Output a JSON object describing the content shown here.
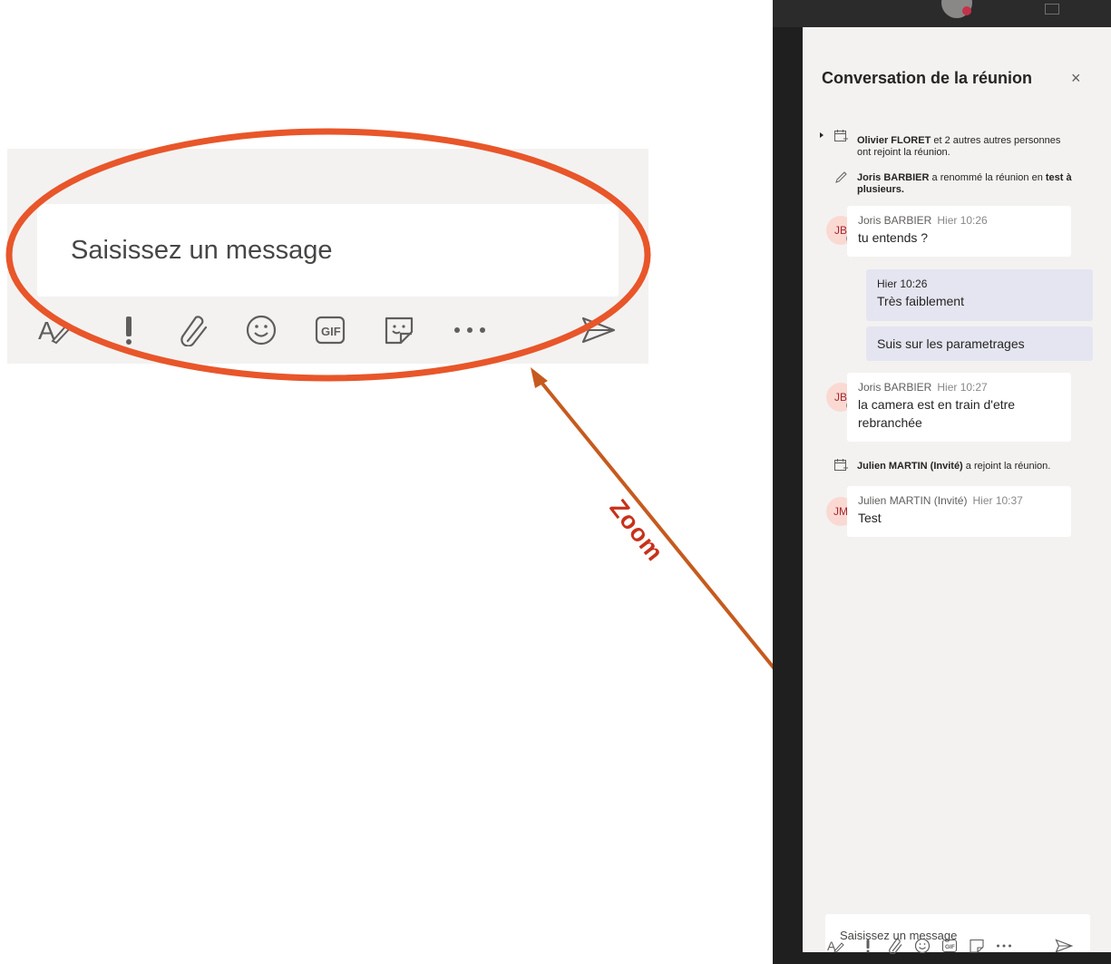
{
  "zoom_composer": {
    "placeholder": "Saisissez un message",
    "toolbar_icons": [
      "format-icon",
      "important-icon",
      "attach-icon",
      "emoji-icon",
      "gif-icon",
      "sticker-icon",
      "more-icon",
      "send-icon"
    ]
  },
  "annotation": {
    "label": "Zoom",
    "color": "#c8311a",
    "ellipse_color": "#e8562a",
    "arrow_color": "#c65a1e"
  },
  "chat": {
    "title": "Conversation de la réunion",
    "close": "×",
    "events": [
      {
        "actor": "Olivier FLORET",
        "text": " et 2 autres autres personnes ont rejoint la réunion."
      },
      {
        "actor": "Joris BARBIER",
        "text": " a renommé la réunion en ",
        "bold_suffix": "test à plusieurs."
      },
      {
        "actor": "Julien MARTIN (Invité)",
        "text": " a rejoint la réunion."
      }
    ],
    "messages": [
      {
        "initials": "JB",
        "author": "Joris BARBIER",
        "time": "Hier 10:26",
        "text": "tu entends ?"
      },
      {
        "time": "Hier 10:26",
        "text": "Très faiblement"
      },
      {
        "text": "Suis sur les parametrages"
      },
      {
        "initials": "JB",
        "author": "Joris BARBIER",
        "time": "Hier 10:27",
        "text": "la camera est en train d'etre rebranchée"
      },
      {
        "initials": "JM",
        "author": "Julien MARTIN (Invité)",
        "time": "Hier 10:37",
        "text": "Test"
      }
    ],
    "compose_placeholder": "Saisissez un message"
  }
}
